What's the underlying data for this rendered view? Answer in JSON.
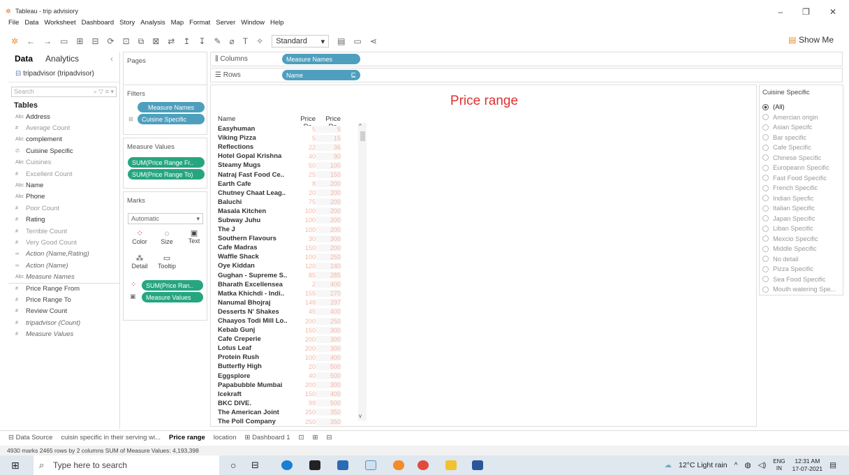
{
  "window": {
    "title": "Tableau - trip advisiory",
    "min": "–",
    "max": "❐",
    "close": "✕"
  },
  "menu": [
    "File",
    "Data",
    "Worksheet",
    "Dashboard",
    "Story",
    "Analysis",
    "Map",
    "Format",
    "Server",
    "Window",
    "Help"
  ],
  "toolbar": {
    "fit_select": "Standard",
    "show_me": "Show Me"
  },
  "data_pane": {
    "tab_data": "Data",
    "tab_analytics": "Analytics",
    "source": "tripadvisor (tripadvisor)",
    "search_placeholder": "Search",
    "tables_heading": "Tables",
    "fields": [
      {
        "icon": "Abc",
        "label": "Address",
        "style": "dim"
      },
      {
        "icon": "#",
        "label": "Average Count",
        "style": "gray"
      },
      {
        "icon": "Abc",
        "label": "complement",
        "style": "dim"
      },
      {
        "icon": "∅",
        "label": "Cuisine Specific",
        "style": "dim"
      },
      {
        "icon": "Abc",
        "label": "Cuisines",
        "style": "gray"
      },
      {
        "icon": "#",
        "label": "Excellent Count",
        "style": "gray"
      },
      {
        "icon": "Abc",
        "label": "Name",
        "style": "dim"
      },
      {
        "icon": "Abc",
        "label": "Phone",
        "style": "dim"
      },
      {
        "icon": "#",
        "label": "Poor Count",
        "style": "gray"
      },
      {
        "icon": "#",
        "label": "Rating",
        "style": "dim"
      },
      {
        "icon": "#",
        "label": "Terrible Count",
        "style": "gray"
      },
      {
        "icon": "#",
        "label": "Very Good Count",
        "style": "gray"
      },
      {
        "icon": "∞",
        "label": "Action (Name,Rating)",
        "style": "ital"
      },
      {
        "icon": "∞",
        "label": "Action (Name)",
        "style": "ital"
      },
      {
        "icon": "Abc",
        "label": "Measure Names",
        "style": "ital"
      },
      {
        "icon": "#",
        "label": "Price Range From",
        "style": "meas"
      },
      {
        "icon": "#",
        "label": "Price Range To",
        "style": "meas"
      },
      {
        "icon": "#",
        "label": "Review Count",
        "style": "meas"
      },
      {
        "icon": "#",
        "label": "tripadvisor (Count)",
        "style": "ital"
      },
      {
        "icon": "#",
        "label": "Measure Values",
        "style": "ital"
      }
    ]
  },
  "pages": {
    "title": "Pages"
  },
  "filters": {
    "title": "Filters",
    "pills": [
      "Measure Names",
      "Cuisine Specific"
    ]
  },
  "measure_values": {
    "title": "Measure Values",
    "pills": [
      "SUM(Price Range Fr..",
      "SUM(Price Range To)"
    ]
  },
  "marks": {
    "title": "Marks",
    "type": "Automatic",
    "buttons": [
      "Color",
      "Size",
      "Text",
      "Detail",
      "Tooltip"
    ],
    "pills": [
      "SUM(Price Ran..",
      "Measure Values"
    ]
  },
  "shelves": {
    "columns_label": "Columns",
    "columns_pill": "Measure Names",
    "rows_label": "Rows",
    "rows_pill": "Name"
  },
  "view": {
    "title": "Price range",
    "col_name": "Name",
    "col_from": "Price Ra..",
    "col_to": "Price Ra..",
    "rows": [
      [
        "Easyhuman",
        "5",
        "5"
      ],
      [
        "Viking Pizza",
        "5",
        "15"
      ],
      [
        "Reflections",
        "22",
        "36"
      ],
      [
        "Hotel Gopal Krishna",
        "40",
        "90"
      ],
      [
        "Steamy Mugs",
        "50",
        "100"
      ],
      [
        "Natraj Fast Food Ce..",
        "25",
        "150"
      ],
      [
        "Earth Cafe",
        "8",
        "200"
      ],
      [
        "Chutney Chaat Leag..",
        "20",
        "200"
      ],
      [
        "Baluchi",
        "75",
        "200"
      ],
      [
        "Masala Kitchen",
        "100",
        "200"
      ],
      [
        "Subway Juhu",
        "100",
        "200"
      ],
      [
        "The J",
        "100",
        "200"
      ],
      [
        "Southern Flavours",
        "30",
        "300"
      ],
      [
        "Cafe Madras",
        "150",
        "200"
      ],
      [
        "Waffle Shack",
        "100",
        "250"
      ],
      [
        "Oye Kiddan",
        "120",
        "240"
      ],
      [
        "Gughan - Supreme S..",
        "85",
        "285"
      ],
      [
        "Bharath Excellensea",
        "2",
        "400"
      ],
      [
        "Matka Khichdi - Indi..",
        "155",
        "270"
      ],
      [
        "Nanumal Bhojraj",
        "148",
        "297"
      ],
      [
        "Desserts N' Shakes",
        "45",
        "400"
      ],
      [
        "Chaayos Todi Mill Lo..",
        "200",
        "250"
      ],
      [
        "Kebab Gunj",
        "150",
        "300"
      ],
      [
        "Cafe Creperie",
        "200",
        "300"
      ],
      [
        "Lotus Leaf",
        "200",
        "300"
      ],
      [
        "Protein Rush",
        "100",
        "400"
      ],
      [
        "Butterfly High",
        "20",
        "500"
      ],
      [
        "Eggsplore",
        "40",
        "500"
      ],
      [
        "Papabubble Mumbai",
        "200",
        "300"
      ],
      [
        "Icekraft",
        "150",
        "400"
      ],
      [
        "BKC DIVE.",
        "99",
        "500"
      ],
      [
        "The American Joint",
        "250",
        "350"
      ],
      [
        "The Poll Company",
        "250",
        "350"
      ]
    ]
  },
  "legend": {
    "title": "Cuisine Specific",
    "options": [
      "(All)",
      "Amercian origin",
      "Asian Specifc",
      "Bar specific",
      "Cafe Specific",
      "Chinese Specific",
      "Europeann Specific",
      "Fast Food Specific",
      "French Specific",
      "Indian Specfic",
      "Italian Specific",
      "Japan Specific",
      "Liban Specific",
      "Mexcio Specific",
      "Middle Specific",
      "No detail",
      "Pizza Specific",
      "Sea Food Specific",
      "Mouth watering Spe..."
    ]
  },
  "sheet_tabs": {
    "data_source": "Data Source",
    "tab1": "cuisin specific in their serving wi...",
    "tab2": "Price range",
    "tab3": "location",
    "tab4": "Dashboard 1"
  },
  "status": "4930 marks   2465 rows by 2 columns   SUM of Measure Values: 4,193,398",
  "taskbar": {
    "search": "Type here to search",
    "weather": "12°C  Light rain",
    "lang": "ENG",
    "lang2": "IN",
    "time": "12:31 AM",
    "date": "17-07-2021"
  }
}
